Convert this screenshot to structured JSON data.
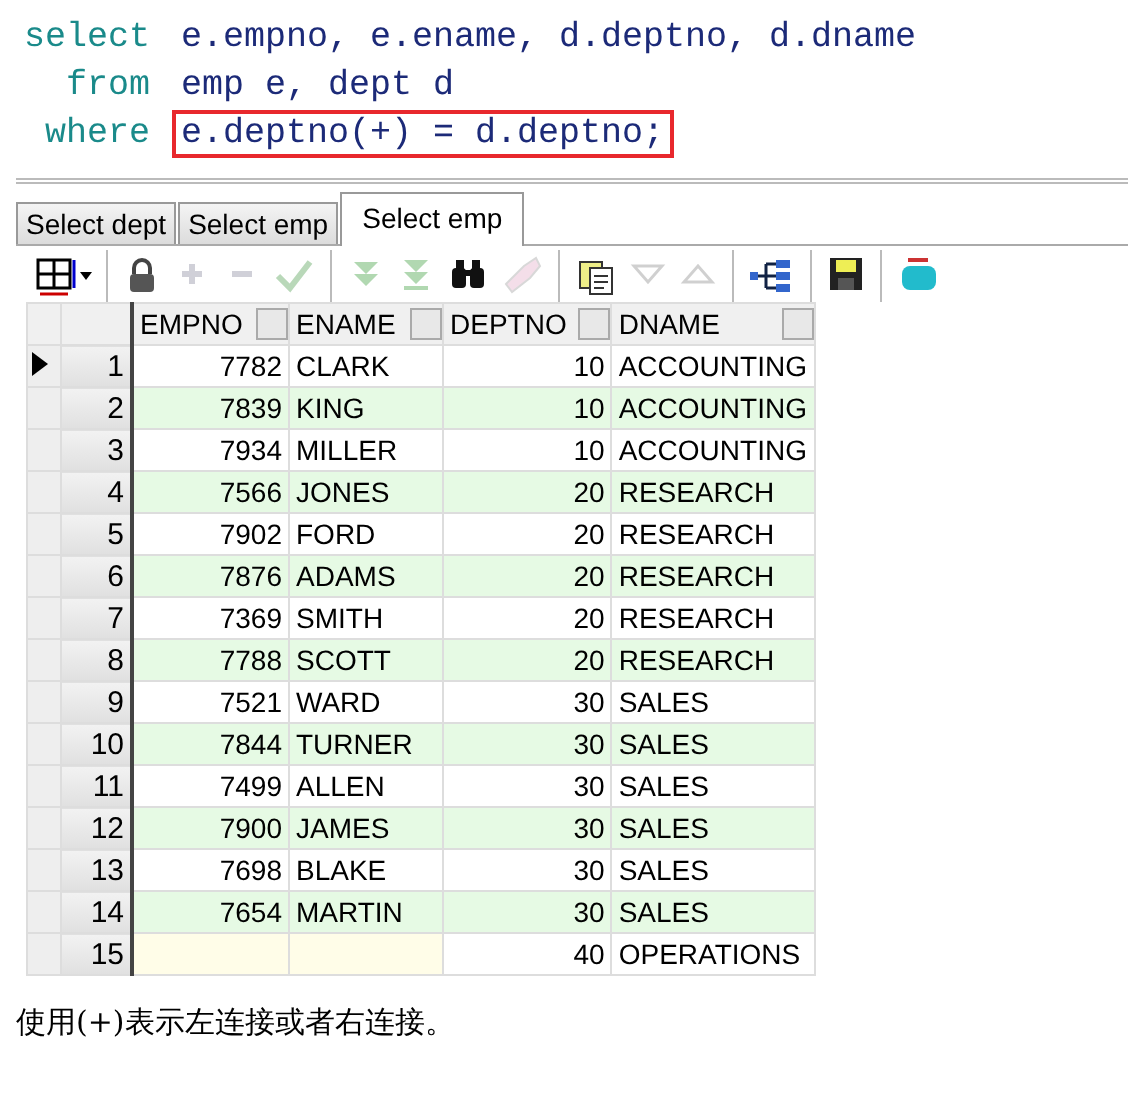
{
  "sql": [
    {
      "keyword": "select",
      "text": "e.empno, e.ename, d.deptno, d.dname",
      "highlighted": false
    },
    {
      "keyword": "from",
      "text": "emp e, dept d",
      "highlighted": false
    },
    {
      "keyword": "where",
      "text": "e.deptno(+) = d.deptno;",
      "highlighted": true
    }
  ],
  "tabs": [
    {
      "label": "Select dept",
      "selected": false
    },
    {
      "label": "Select emp",
      "selected": false
    },
    {
      "label": "Select emp",
      "selected": true
    }
  ],
  "toolbar": [
    {
      "kind": "grid",
      "disabled": false
    },
    {
      "kind": "sep"
    },
    {
      "kind": "lock",
      "disabled": false
    },
    {
      "kind": "plus",
      "disabled": true
    },
    {
      "kind": "minus",
      "disabled": true
    },
    {
      "kind": "check",
      "disabled": true
    },
    {
      "kind": "sep"
    },
    {
      "kind": "down2",
      "disabled": true
    },
    {
      "kind": "down2bar",
      "disabled": true
    },
    {
      "kind": "binoculars",
      "disabled": false
    },
    {
      "kind": "eraser",
      "disabled": true
    },
    {
      "kind": "sep"
    },
    {
      "kind": "docs",
      "disabled": false
    },
    {
      "kind": "tridown",
      "disabled": true
    },
    {
      "kind": "triup",
      "disabled": true
    },
    {
      "kind": "sep"
    },
    {
      "kind": "tree",
      "disabled": false
    },
    {
      "kind": "sep"
    },
    {
      "kind": "save",
      "disabled": false
    },
    {
      "kind": "sep"
    },
    {
      "kind": "export",
      "disabled": false
    }
  ],
  "table": {
    "columns": [
      "EMPNO",
      "ENAME",
      "DEPTNO",
      "DNAME"
    ],
    "rows": [
      {
        "num": "1",
        "selected": true,
        "cells": [
          "7782",
          "CLARK",
          "10",
          "ACCOUNTING"
        ]
      },
      {
        "num": "2",
        "selected": false,
        "cells": [
          "7839",
          "KING",
          "10",
          "ACCOUNTING"
        ]
      },
      {
        "num": "3",
        "selected": false,
        "cells": [
          "7934",
          "MILLER",
          "10",
          "ACCOUNTING"
        ]
      },
      {
        "num": "4",
        "selected": false,
        "cells": [
          "7566",
          "JONES",
          "20",
          "RESEARCH"
        ]
      },
      {
        "num": "5",
        "selected": false,
        "cells": [
          "7902",
          "FORD",
          "20",
          "RESEARCH"
        ]
      },
      {
        "num": "6",
        "selected": false,
        "cells": [
          "7876",
          "ADAMS",
          "20",
          "RESEARCH"
        ]
      },
      {
        "num": "7",
        "selected": false,
        "cells": [
          "7369",
          "SMITH",
          "20",
          "RESEARCH"
        ]
      },
      {
        "num": "8",
        "selected": false,
        "cells": [
          "7788",
          "SCOTT",
          "20",
          "RESEARCH"
        ]
      },
      {
        "num": "9",
        "selected": false,
        "cells": [
          "7521",
          "WARD",
          "30",
          "SALES"
        ]
      },
      {
        "num": "10",
        "selected": false,
        "cells": [
          "7844",
          "TURNER",
          "30",
          "SALES"
        ]
      },
      {
        "num": "11",
        "selected": false,
        "cells": [
          "7499",
          "ALLEN",
          "30",
          "SALES"
        ]
      },
      {
        "num": "12",
        "selected": false,
        "cells": [
          "7900",
          "JAMES",
          "30",
          "SALES"
        ]
      },
      {
        "num": "13",
        "selected": false,
        "cells": [
          "7698",
          "BLAKE",
          "30",
          "SALES"
        ]
      },
      {
        "num": "14",
        "selected": false,
        "cells": [
          "7654",
          "MARTIN",
          "30",
          "SALES"
        ]
      },
      {
        "num": "15",
        "selected": false,
        "cells": [
          null,
          null,
          "40",
          "OPERATIONS"
        ]
      }
    ]
  },
  "caption": "使用(+)表示左连接或者右连接。"
}
